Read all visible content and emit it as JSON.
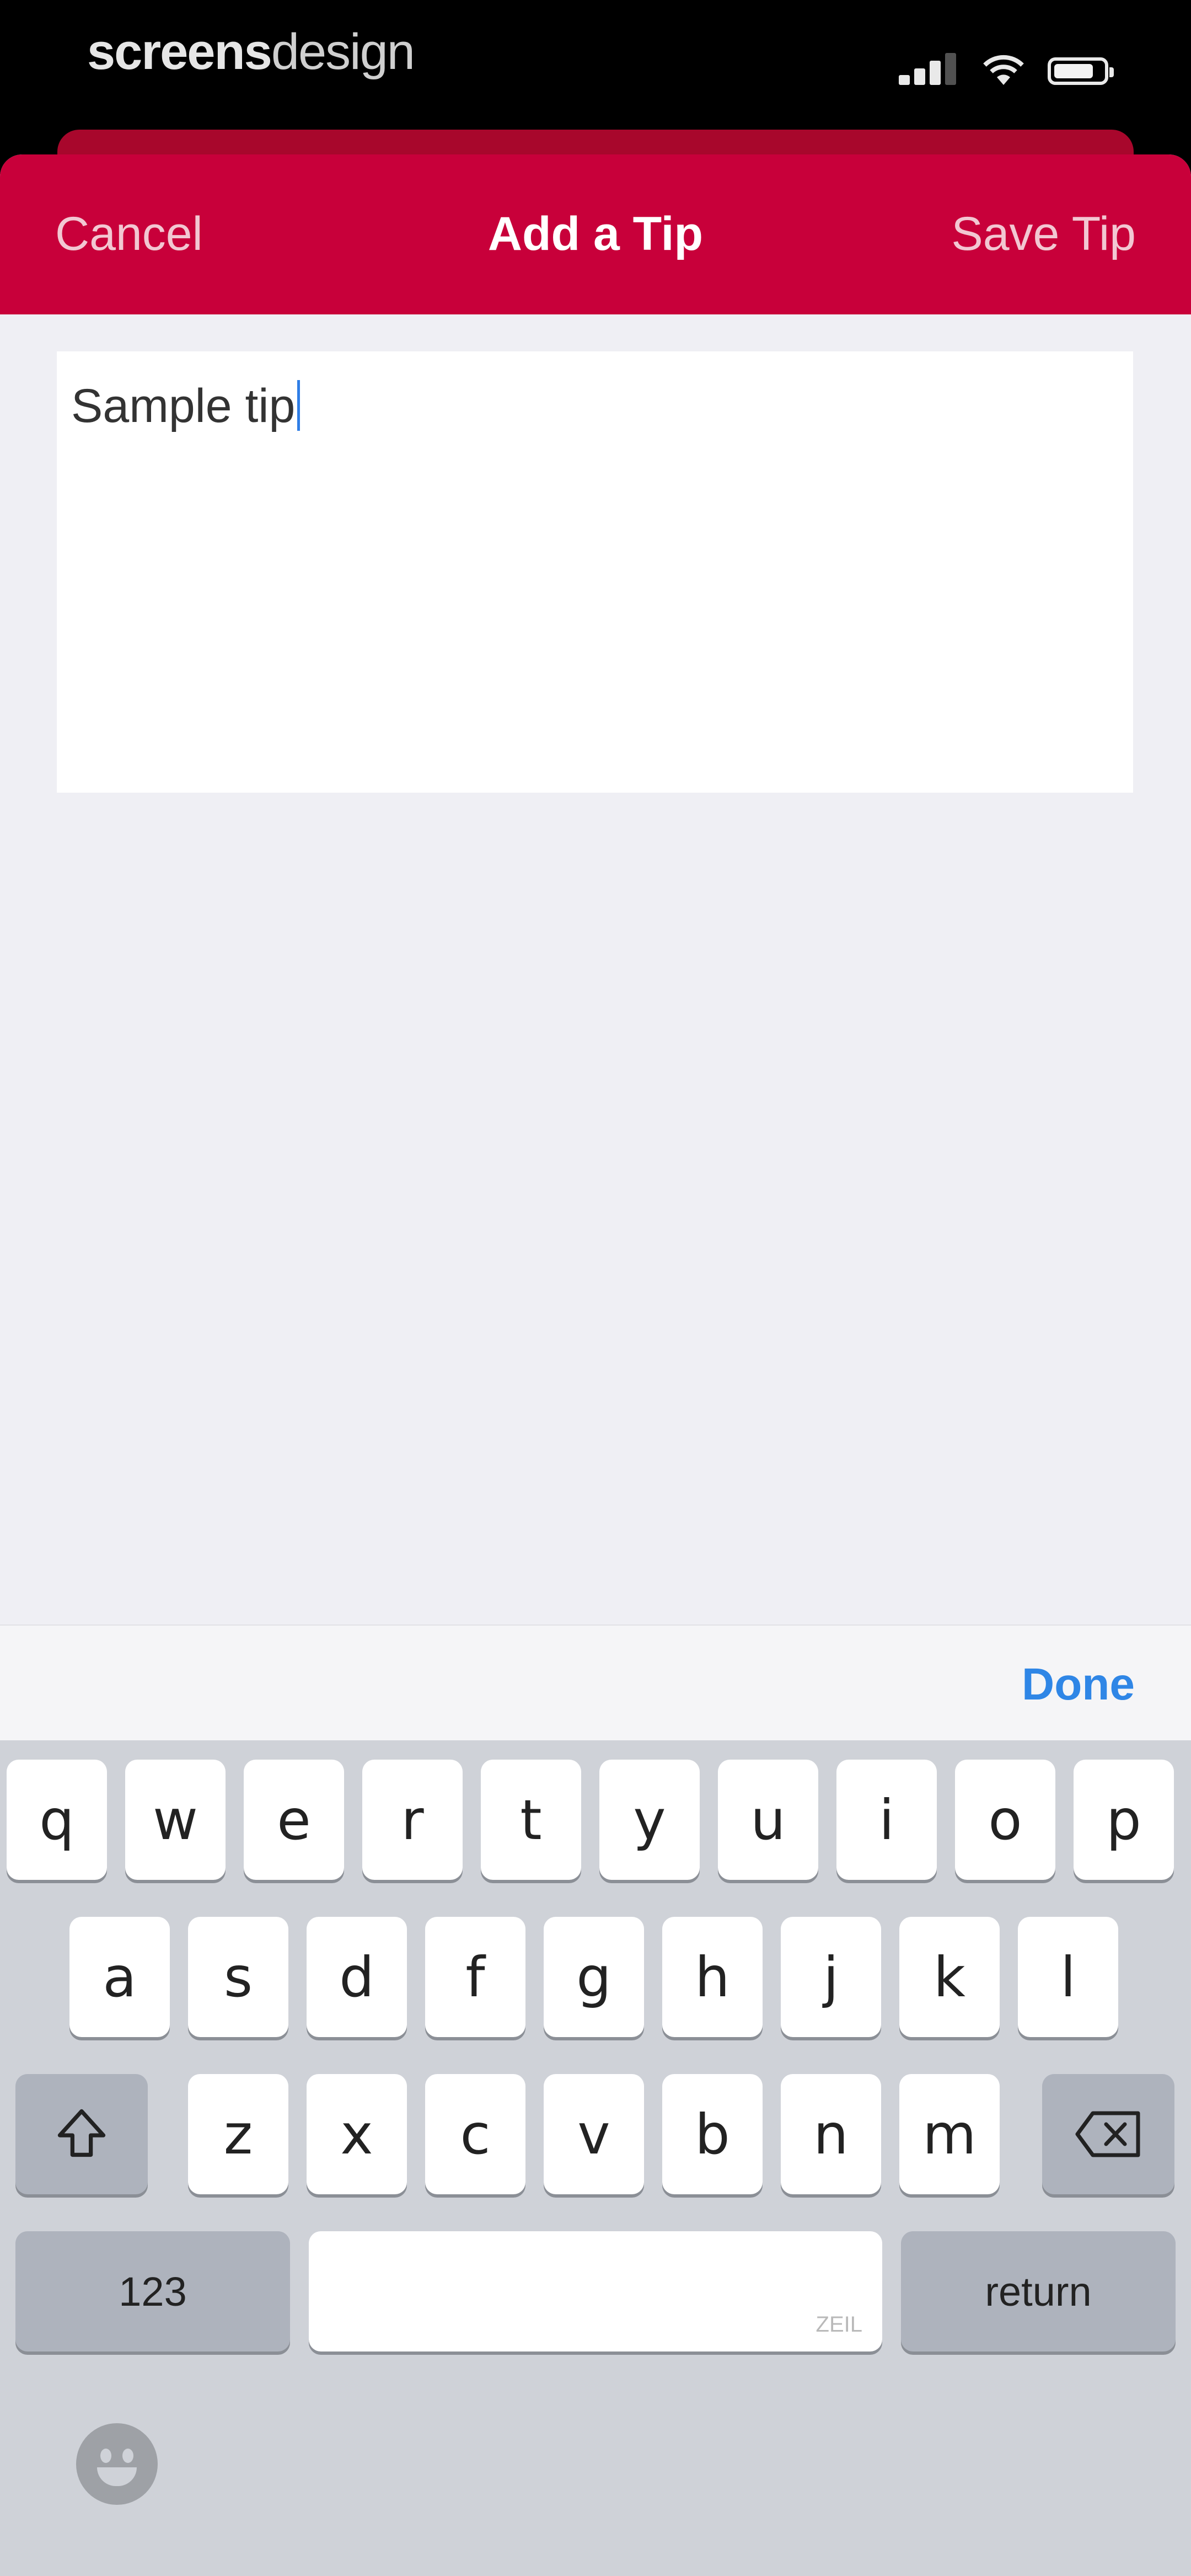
{
  "status_bar": {
    "brand_part1": "screens",
    "brand_part2": "design"
  },
  "nav": {
    "cancel_label": "Cancel",
    "title": "Add a Tip",
    "save_label": "Save Tip",
    "accent_color": "#c8003a"
  },
  "tip_input": {
    "value": "Sample tip"
  },
  "accessory": {
    "done_label": "Done"
  },
  "keyboard": {
    "row1": [
      "q",
      "w",
      "e",
      "r",
      "t",
      "y",
      "u",
      "i",
      "o",
      "p"
    ],
    "row2": [
      "a",
      "s",
      "d",
      "f",
      "g",
      "h",
      "j",
      "k",
      "l"
    ],
    "row3": [
      "z",
      "x",
      "c",
      "v",
      "b",
      "n",
      "m"
    ],
    "numbers_label": "123",
    "return_label": "return",
    "space_hint": "ZEIL",
    "icons": [
      "shift-icon",
      "backspace-icon",
      "emoji-icon"
    ]
  }
}
